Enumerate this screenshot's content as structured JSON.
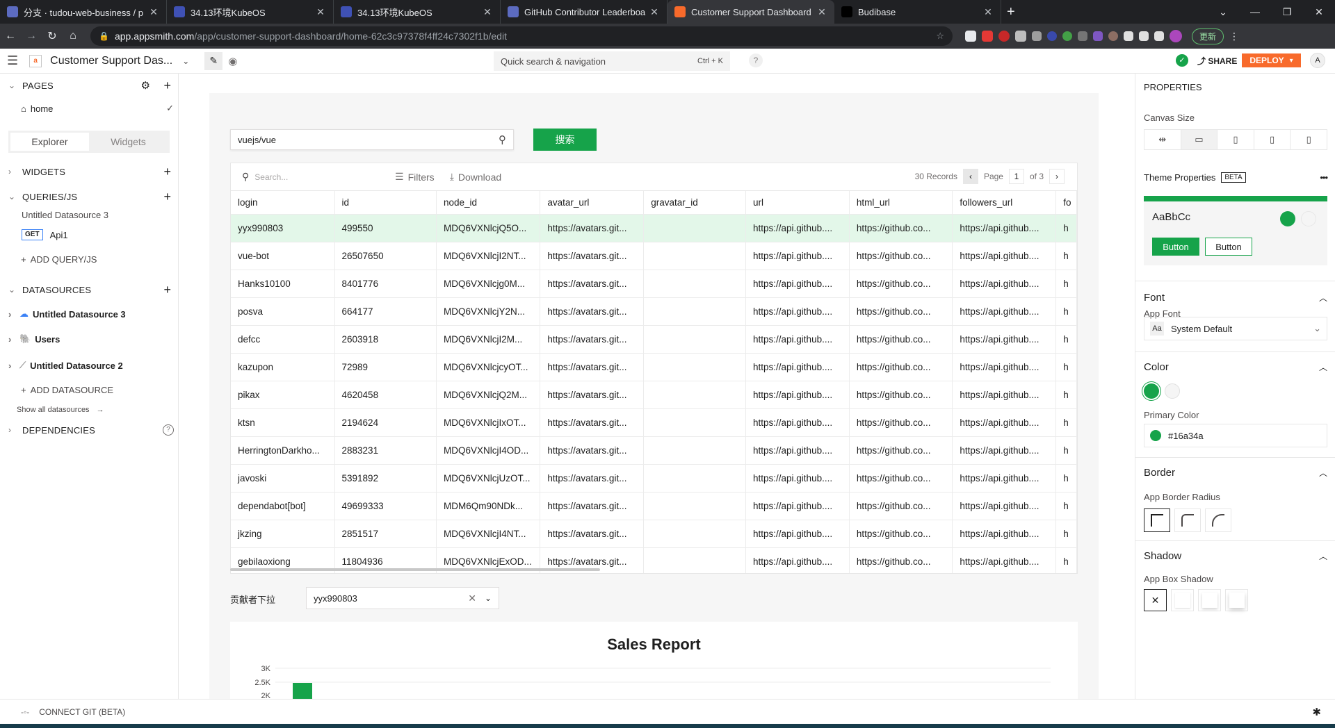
{
  "browser": {
    "tabs": [
      {
        "title": "分支 · tudou-web-business / p",
        "fav": "#5c6bc0"
      },
      {
        "title": "34.13环境KubeOS",
        "fav": "#3f51b5"
      },
      {
        "title": "34.13环境KubeOS",
        "fav": "#3f51b5"
      },
      {
        "title": "GitHub Contributor Leaderboa",
        "fav": "#5c6bc0"
      },
      {
        "title": "Customer Support Dashboard",
        "fav": "#f86a2b"
      },
      {
        "title": "Budibase",
        "fav": "#000000"
      }
    ],
    "url_host": "app.appsmith.com",
    "url_path": "/app/customer-support-dashboard/home-62c3c97378f4ff24c7302f1b/edit",
    "update_label": "更新"
  },
  "header": {
    "app_name": "Customer Support Das...",
    "quick_search": "Quick search & navigation",
    "quick_search_kbd": "Ctrl + K",
    "help": "?",
    "share": "SHARE",
    "deploy": "DEPLOY",
    "avatar": "A"
  },
  "sidebar": {
    "pages_label": "PAGES",
    "page_home": "home",
    "tab_explorer": "Explorer",
    "tab_widgets": "Widgets",
    "widgets_label": "WIDGETS",
    "queries_label": "QUERIES/JS",
    "query_ds": "Untitled Datasource 3",
    "api_method": "GET",
    "api_name": "Api1",
    "add_query": "ADD QUERY/JS",
    "datasources_label": "DATASOURCES",
    "datasources": [
      "Untitled Datasource 3",
      "Users",
      "Untitled Datasource 2"
    ],
    "add_datasource": "ADD DATASOURCE",
    "show_all": "Show all datasources",
    "dependencies_label": "DEPENDENCIES"
  },
  "canvas": {
    "search_value": "vuejs/vue",
    "search_button": "搜索",
    "table": {
      "search_placeholder": "Search...",
      "filters": "Filters",
      "download": "Download",
      "records": "30 Records",
      "page_label": "Page",
      "page_num": "1",
      "page_of": "of 3",
      "columns": [
        "login",
        "id",
        "node_id",
        "avatar_url",
        "gravatar_id",
        "url",
        "html_url",
        "followers_url",
        "fo"
      ],
      "rows": [
        [
          "yyx990803",
          "499550",
          "MDQ6VXNlcjQ5O...",
          "https://avatars.git...",
          "",
          "https://api.github....",
          "https://github.co...",
          "https://api.github....",
          "h"
        ],
        [
          "vue-bot",
          "26507650",
          "MDQ6VXNlcjI2NT...",
          "https://avatars.git...",
          "",
          "https://api.github....",
          "https://github.co...",
          "https://api.github....",
          "h"
        ],
        [
          "Hanks10100",
          "8401776",
          "MDQ6VXNlcjg0M...",
          "https://avatars.git...",
          "",
          "https://api.github....",
          "https://github.co...",
          "https://api.github....",
          "h"
        ],
        [
          "posva",
          "664177",
          "MDQ6VXNlcjY2N...",
          "https://avatars.git...",
          "",
          "https://api.github....",
          "https://github.co...",
          "https://api.github....",
          "h"
        ],
        [
          "defcc",
          "2603918",
          "MDQ6VXNlcjI2M...",
          "https://avatars.git...",
          "",
          "https://api.github....",
          "https://github.co...",
          "https://api.github....",
          "h"
        ],
        [
          "kazupon",
          "72989",
          "MDQ6VXNlcjcyOT...",
          "https://avatars.git...",
          "",
          "https://api.github....",
          "https://github.co...",
          "https://api.github....",
          "h"
        ],
        [
          "pikax",
          "4620458",
          "MDQ6VXNlcjQ2M...",
          "https://avatars.git...",
          "",
          "https://api.github....",
          "https://github.co...",
          "https://api.github....",
          "h"
        ],
        [
          "ktsn",
          "2194624",
          "MDQ6VXNlcjIxOT...",
          "https://avatars.git...",
          "",
          "https://api.github....",
          "https://github.co...",
          "https://api.github....",
          "h"
        ],
        [
          "HerringtonDarkho...",
          "2883231",
          "MDQ6VXNlcjI4OD...",
          "https://avatars.git...",
          "",
          "https://api.github....",
          "https://github.co...",
          "https://api.github....",
          "h"
        ],
        [
          "javoski",
          "5391892",
          "MDQ6VXNlcjUzOT...",
          "https://avatars.git...",
          "",
          "https://api.github....",
          "https://github.co...",
          "https://api.github....",
          "h"
        ],
        [
          "dependabot[bot]",
          "49699333",
          "MDM6Qm90NDk...",
          "https://avatars.git...",
          "",
          "https://api.github....",
          "https://github.co...",
          "https://api.github....",
          "h"
        ],
        [
          "jkzing",
          "2851517",
          "MDQ6VXNlcjI4NT...",
          "https://avatars.git...",
          "",
          "https://api.github....",
          "https://github.co...",
          "https://api.github....",
          "h"
        ],
        [
          "gebilaoxiong",
          "11804936",
          "MDQ6VXNlcjExOD...",
          "https://avatars.git...",
          "",
          "https://api.github....",
          "https://github.co...",
          "https://api.github....",
          "h"
        ]
      ]
    },
    "dropdown_label": "贡献者下拉",
    "dropdown_value": "yyx990803",
    "chart": {
      "title": "Sales Report",
      "y_ticks": [
        "3K",
        "2.5K",
        "2K"
      ]
    }
  },
  "footer": {
    "connect_git": "CONNECT GIT (BETA)"
  },
  "properties": {
    "title": "PROPERTIES",
    "canvas_size": "Canvas Size",
    "theme_properties": "Theme Properties",
    "beta": "BETA",
    "more": "•••",
    "theme_sample": "AaBbCc",
    "btn_primary": "Button",
    "btn_secondary": "Button",
    "font": "Font",
    "app_font": "App Font",
    "font_value": "System Default",
    "color": "Color",
    "primary_color": "Primary Color",
    "primary_color_value": "#16a34a",
    "border": "Border",
    "app_border_radius": "App Border Radius",
    "shadow": "Shadow",
    "app_box_shadow": "App Box Shadow",
    "accent": "#16a34a"
  }
}
